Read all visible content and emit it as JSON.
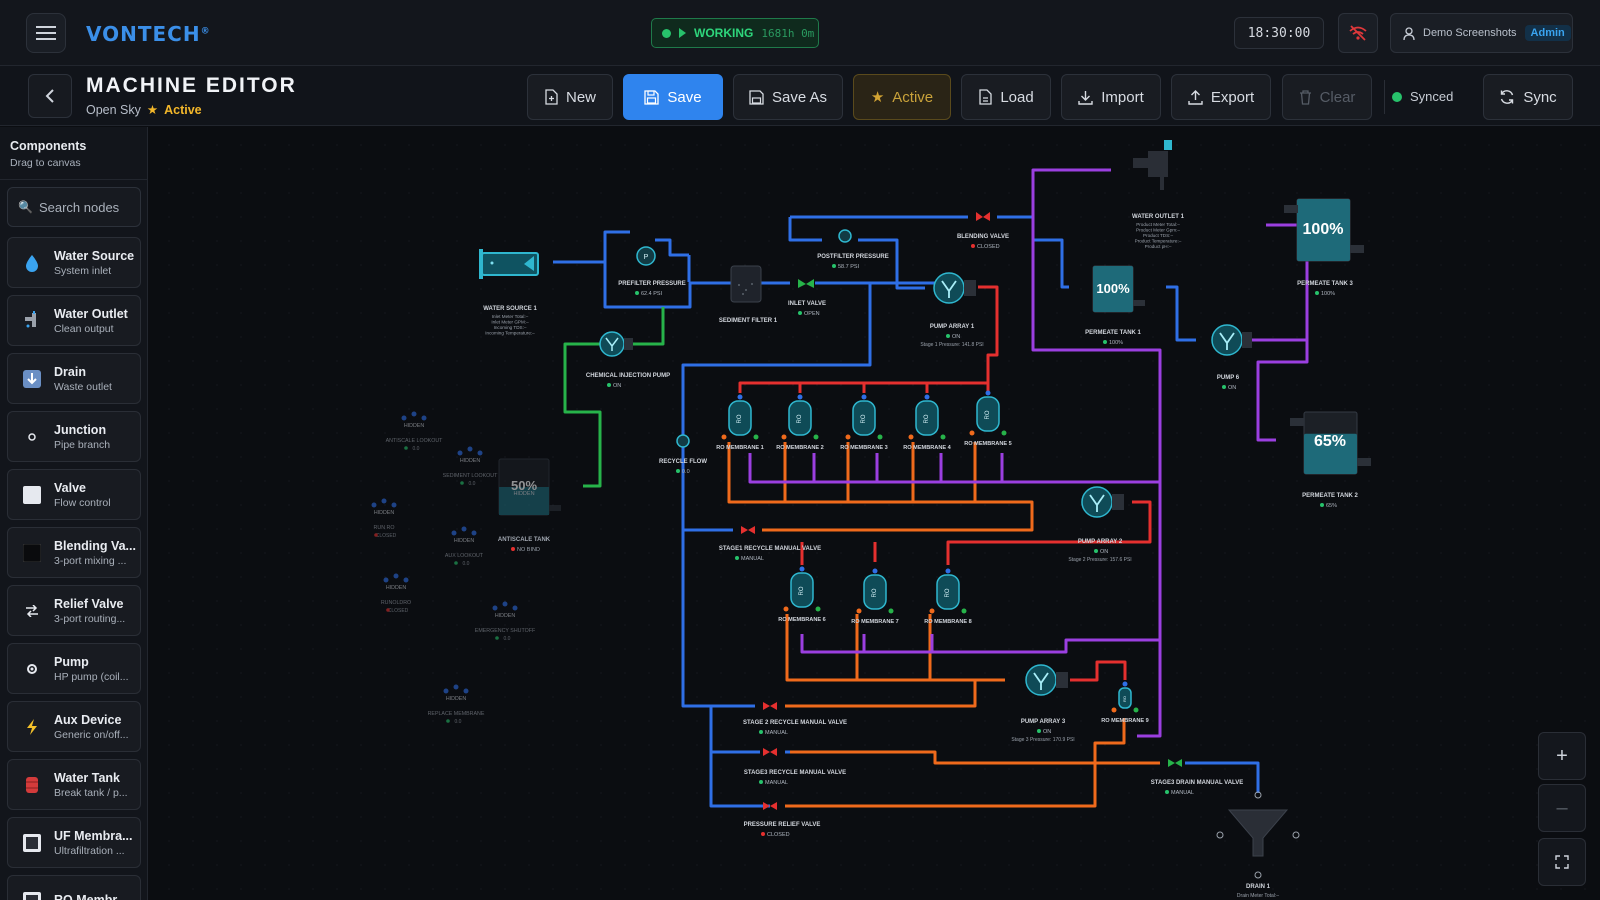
{
  "app": {
    "logo": "VONTECH",
    "logo_mark": "®"
  },
  "status": {
    "state": "WORKING",
    "uptime": "1681h 0m",
    "clock": "18:30:00"
  },
  "user": {
    "name": "Demo Screenshots",
    "role": "Admin"
  },
  "page": {
    "title": "MACHINE EDITOR",
    "config_name": "Open Sky",
    "config_state": "Active"
  },
  "toolbar": {
    "new": "New",
    "save": "Save",
    "save_as": "Save As",
    "active": "Active",
    "load": "Load",
    "import": "Import",
    "export": "Export",
    "clear": "Clear",
    "synced": "Synced",
    "sync": "Sync"
  },
  "sidebar": {
    "title": "Components",
    "subtitle": "Drag to canvas",
    "search_placeholder": "Search nodes",
    "items": [
      {
        "name": "Water Source",
        "desc": "System inlet",
        "icon": "water-drop-icon"
      },
      {
        "name": "Water Outlet",
        "desc": "Clean output",
        "icon": "faucet-icon"
      },
      {
        "name": "Drain",
        "desc": "Waste outlet",
        "icon": "drain-arrow-icon"
      },
      {
        "name": "Junction",
        "desc": "Pipe branch",
        "icon": "junction-icon"
      },
      {
        "name": "Valve",
        "desc": "Flow control",
        "icon": "valve-icon"
      },
      {
        "name": "Blending Va...",
        "desc": "3-port mixing ...",
        "icon": "blending-valve-icon"
      },
      {
        "name": "Relief Valve",
        "desc": "3-port routing...",
        "icon": "relief-valve-icon"
      },
      {
        "name": "Pump",
        "desc": "HP pump (coil...",
        "icon": "gear-icon"
      },
      {
        "name": "Aux Device",
        "desc": "Generic on/off...",
        "icon": "lightning-icon"
      },
      {
        "name": "Water Tank",
        "desc": "Break tank / p...",
        "icon": "tank-icon"
      },
      {
        "name": "UF Membra...",
        "desc": "Ultrafiltration ...",
        "icon": "membrane-icon"
      },
      {
        "name": "RO Membr...",
        "desc": "",
        "icon": "membrane-icon"
      }
    ]
  },
  "colors": {
    "accent": "#2f84ee",
    "feed": "#2f6fe6",
    "chem": "#27b34a",
    "hp": "#e5302f",
    "concentrate": "#f06a1c",
    "permeate": "#9b3fe0",
    "ok": "#27c26b"
  },
  "canvas": {
    "water_source": {
      "label": "WATER SOURCE 1",
      "lines": [
        "Inlet Meter Total:–",
        "Inlet Meter GPM:–",
        "Incoming TDS:–",
        "Incoming Temperature:–"
      ]
    },
    "prefilter": {
      "label": "PREFILTER PRESSURE",
      "value": "62.4",
      "unit": "PSI",
      "glyph": "P"
    },
    "sediment_filter": {
      "label": "SEDIMENT FILTER 1"
    },
    "inlet_valve": {
      "label": "INLET VALVE",
      "state": "OPEN"
    },
    "postfilter": {
      "label": "POSTFILTER PRESSURE",
      "value": "58.7",
      "unit": "PSI"
    },
    "blending_valve": {
      "label": "BLENDING VALVE",
      "state": "CLOSED"
    },
    "water_outlet": {
      "label": "WATER OUTLET 1",
      "lines": [
        "Product Meter Total:–",
        "Product Meter Gpm:–",
        "Product TDS:–",
        "Product Temperature:–",
        "Product pH:–"
      ]
    },
    "pump_array_1": {
      "label": "PUMP ARRAY 1",
      "state": "ON",
      "detail": "Stage 1 Pressure: 141.8 PSI"
    },
    "pump_array_2": {
      "label": "PUMP ARRAY 2",
      "state": "ON",
      "detail": "Stage 2 Pressure: 157.6 PSI"
    },
    "pump_array_3": {
      "label": "PUMP ARRAY 3",
      "state": "ON",
      "detail": "Stage 3 Pressure: 170.9 PSI"
    },
    "pump_6": {
      "label": "PUMP 6",
      "state": "ON"
    },
    "chem_pump": {
      "label": "CHEMICAL INJECTION PUMP",
      "state": "ON"
    },
    "recycle_flow": {
      "label": "RECYCLE FLOW",
      "value": "0.0"
    },
    "permeate_tank_1": {
      "label": "PERMEATE TANK 1",
      "level": "100%",
      "fill": 1.0
    },
    "permeate_tank_2": {
      "label": "PERMEATE TANK 2",
      "level": "65%",
      "fill": 0.65
    },
    "permeate_tank_3": {
      "label": "PERMEATE TANK 3",
      "level": "100%",
      "fill": 1.0
    },
    "membranes": [
      "RO MEMBRANE 1",
      "RO MEMBRANE 2",
      "RO MEMBRANE 3",
      "RO MEMBRANE 4",
      "RO MEMBRANE 5",
      "RO MEMBRANE 6",
      "RO MEMBRANE 7",
      "RO MEMBRANE 8",
      "RO MEMBRANE 9"
    ],
    "membrane_glyph": "RO",
    "valves": {
      "stage1": {
        "label": "STAGE1 RECYCLE MANUAL VALVE",
        "state": "MANUAL"
      },
      "stage2": {
        "label": "STAGE 2 RECYCLE MANUAL VALVE",
        "state": "MANUAL"
      },
      "stage3": {
        "label": "STAGE3 RECYCLE MANUAL VALVE",
        "state": "MANUAL"
      },
      "relief": {
        "label": "PRESSURE RELIEF VALVE",
        "state": "CLOSED"
      },
      "drain_manual": {
        "label": "STAGE3 DRAIN MANUAL VALVE",
        "state": "MANUAL"
      }
    },
    "drain": {
      "label": "DRAIN 1",
      "line": "Drain Meter Total:–"
    },
    "hidden_tag": "HIDDEN",
    "hidden": [
      {
        "label": "ANTISCALE LOOKOUT",
        "value": "0.0"
      },
      {
        "label": "SEDIMENT LOOKOUT",
        "value": "0.0"
      },
      {
        "label": "RUN RO",
        "value": "CLOSED"
      },
      {
        "label": "AUX LOOKOUT",
        "value": "0.0"
      },
      {
        "label": "RUNOLDRO",
        "value": "CLOSED"
      },
      {
        "label": "EMERGENCY SHUTOFF",
        "value": "0.0"
      },
      {
        "label": "REPLACE MEMBRANE",
        "value": "0.0"
      }
    ],
    "antiscale_tank": {
      "label": "ANTISCALE TANK",
      "level": "50%",
      "state": "NO BIND"
    }
  },
  "zoom": {
    "in": "+",
    "out": "–"
  }
}
